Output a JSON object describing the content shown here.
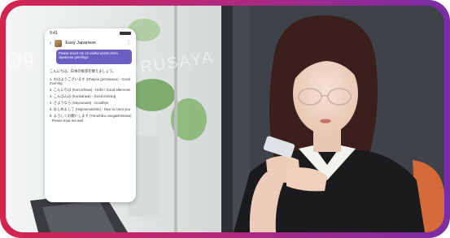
{
  "colors": {
    "frame_left": "#d3244e",
    "frame_right": "#7a2ca8",
    "chat_bubble": "#6b5fc4"
  },
  "phone": {
    "status_time": "9:41",
    "chat_title": "Easy Japanese",
    "bubble_text": "Please teach me 10 useful words when Japanese greetings",
    "reply_intro": "こんにちは、日本の挨拶を教えましょう。",
    "reply_items": [
      "1. おはようございます (Ohayou gozaimasu) - Good morning",
      "2. こんにちは (Konnichiwa) - Hello / Good afternoon",
      "3. こんばんは (Konbanwa) - Good evening",
      "4. さようなら (Sayounara) - Goodbye",
      "5. はじめまして (Hajimemashite) - Nice to meet you",
      "6. よろしくお願いします (Yoroshiku onegaishimasu) - Please treat me well"
    ]
  },
  "background": {
    "left_sign": "O9",
    "signage": "ARUSAYA"
  }
}
